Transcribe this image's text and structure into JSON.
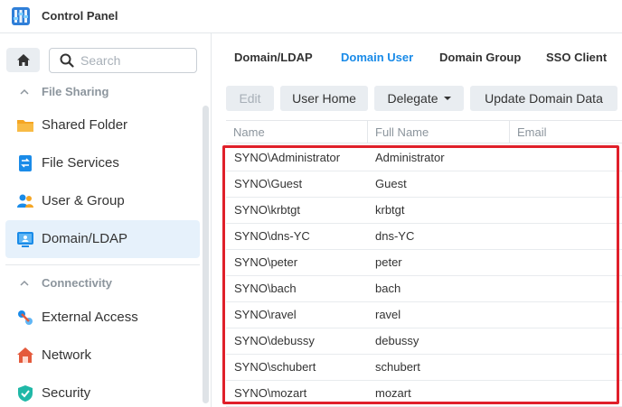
{
  "app": {
    "title": "Control Panel",
    "icon": "control-panel-icon"
  },
  "sidebar": {
    "search_placeholder": "Search",
    "sections": [
      {
        "label": "File Sharing",
        "items": [
          {
            "label": "Shared Folder",
            "icon": "folder-icon",
            "color": "#f5a623"
          },
          {
            "label": "File Services",
            "icon": "file-services-icon",
            "color": "#1a8be8"
          },
          {
            "label": "User & Group",
            "icon": "user-group-icon",
            "color": "#1a8be8"
          },
          {
            "label": "Domain/LDAP",
            "icon": "domain-ldap-icon",
            "color": "#1a8be8",
            "active": true
          }
        ]
      },
      {
        "label": "Connectivity",
        "items": [
          {
            "label": "External Access",
            "icon": "external-access-icon",
            "color": "#1a8be8"
          },
          {
            "label": "Network",
            "icon": "network-icon",
            "color": "#e45a3c"
          },
          {
            "label": "Security",
            "icon": "security-shield-icon",
            "color": "#20b8a7"
          }
        ]
      }
    ]
  },
  "main": {
    "tabs": [
      {
        "label": "Domain/LDAP",
        "active": false
      },
      {
        "label": "Domain User",
        "active": true
      },
      {
        "label": "Domain Group",
        "active": false
      },
      {
        "label": "SSO Client",
        "active": false
      }
    ],
    "toolbar": {
      "edit": "Edit",
      "user_home": "User Home",
      "delegate": "Delegate",
      "update_domain_data": "Update Domain Data"
    },
    "table": {
      "columns": [
        "Name",
        "Full Name",
        "Email"
      ],
      "rows": [
        {
          "name": "SYNO\\Administrator",
          "full_name": "Administrator",
          "email": ""
        },
        {
          "name": "SYNO\\Guest",
          "full_name": "Guest",
          "email": ""
        },
        {
          "name": "SYNO\\krbtgt",
          "full_name": "krbtgt",
          "email": ""
        },
        {
          "name": "SYNO\\dns-YC",
          "full_name": "dns-YC",
          "email": ""
        },
        {
          "name": "SYNO\\peter",
          "full_name": "peter",
          "email": ""
        },
        {
          "name": "SYNO\\bach",
          "full_name": "bach",
          "email": ""
        },
        {
          "name": "SYNO\\ravel",
          "full_name": "ravel",
          "email": ""
        },
        {
          "name": "SYNO\\debussy",
          "full_name": "debussy",
          "email": ""
        },
        {
          "name": "SYNO\\schubert",
          "full_name": "schubert",
          "email": ""
        },
        {
          "name": "SYNO\\mozart",
          "full_name": "mozart",
          "email": ""
        }
      ]
    },
    "accent_color": "#1a8be8",
    "highlight_color": "#e0202a"
  }
}
